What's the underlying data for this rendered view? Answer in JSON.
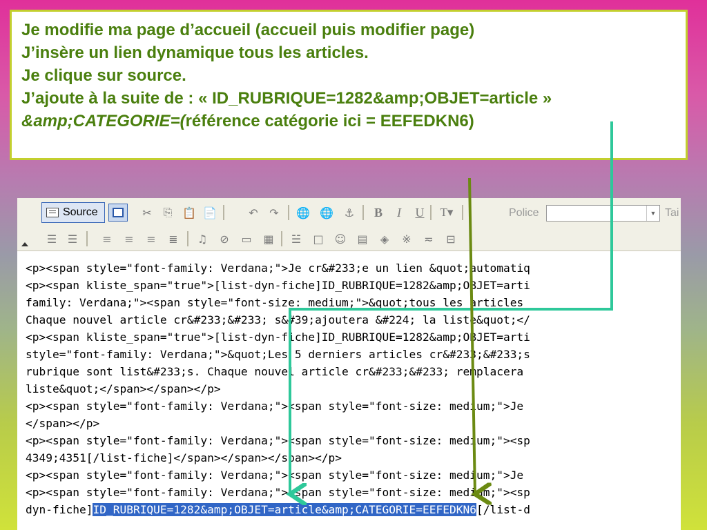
{
  "slide": {
    "lines": [
      "Je modifie ma page d’accueil (accueil puis modifier page)",
      "J’insère un lien dynamique tous les articles.",
      "Je clique sur source.",
      "J’ajoute à la suite de : « ID_RUBRIQUE=1282&amp;OBJET=article »"
    ],
    "line5_italic": "&amp;CATEGORIE=(",
    "line5_rest": "référence catégorie ici = EEFEDKN6)"
  },
  "toolbar": {
    "source_label": "Source",
    "police_label": "Police",
    "taille_label": "Tai",
    "icons_row1": [
      "cut-icon",
      "copy-icon",
      "paste-icon",
      "paste-word-icon",
      "undo-icon",
      "redo-icon",
      "link-icon",
      "unlink-icon",
      "anchor-icon",
      "bold-icon",
      "italic-icon",
      "underline-icon",
      "text-color-icon"
    ],
    "icons_row2": [
      "ordered-list-icon",
      "unordered-list-icon",
      "align-left-icon",
      "align-center-icon",
      "align-right-icon",
      "justify-icon",
      "flash-icon",
      "ie-icon",
      "image-icon",
      "film-icon",
      "dynamic-list-icon",
      "frame-icon",
      "smiley-icon",
      "table-icon",
      "3d-icon",
      "special-char-icon",
      "insert-icon",
      "row-icon"
    ]
  },
  "code_lines": [
    "<p><span style=\"font-family: Verdana;\">Je cr&#233;e un lien &quot;automatiq",
    "<p><span kliste_span=\"true\">[list-dyn-fiche]ID_RUBRIQUE=1282&amp;OBJET=arti",
    "family: Verdana;\"><span style=\"font-size: medium;\">&quot;tous les articles",
    "Chaque nouvel article cr&#233;&#233; s&#39;ajoutera &#224; la liste&quot;</",
    "<p><span kliste_span=\"true\">[list-dyn-fiche]ID_RUBRIQUE=1282&amp;OBJET=arti",
    "style=\"font-family: Verdana;\">&quot;Les 5 derniers articles cr&#233;&#233;s",
    "rubrique sont list&#233;s. Chaque nouvel article cr&#233;&#233; remplacera",
    "liste&quot;</span></span></p>",
    "<p><span style=\"font-family: Verdana;\"><span style=\"font-size: medium;\">Je",
    "</span></p>",
    "<p><span style=\"font-family: Verdana;\"><span style=\"font-size: medium;\"><sp",
    "4349;4351[/list-fiche]</span></span></span></p>",
    "<p><span style=\"font-family: Verdana;\"><span style=\"font-size: medium;\">Je",
    "<p><span style=\"font-family: Verdana;\"><span style=\"font-size: medium;\"><sp"
  ],
  "last_line": {
    "prefix": "dyn-fiche]",
    "highlight": "ID_RUBRIQUE=1282&amp;OBJET=article&amp;CATEGORIE=EEFEDKN6",
    "suffix": "[/list-d"
  },
  "colors": {
    "title_green": "#4a7f0e",
    "arrow_teal": "#2ec89a",
    "arrow_olive": "#6b8a12",
    "selection_blue": "#3166c6"
  }
}
